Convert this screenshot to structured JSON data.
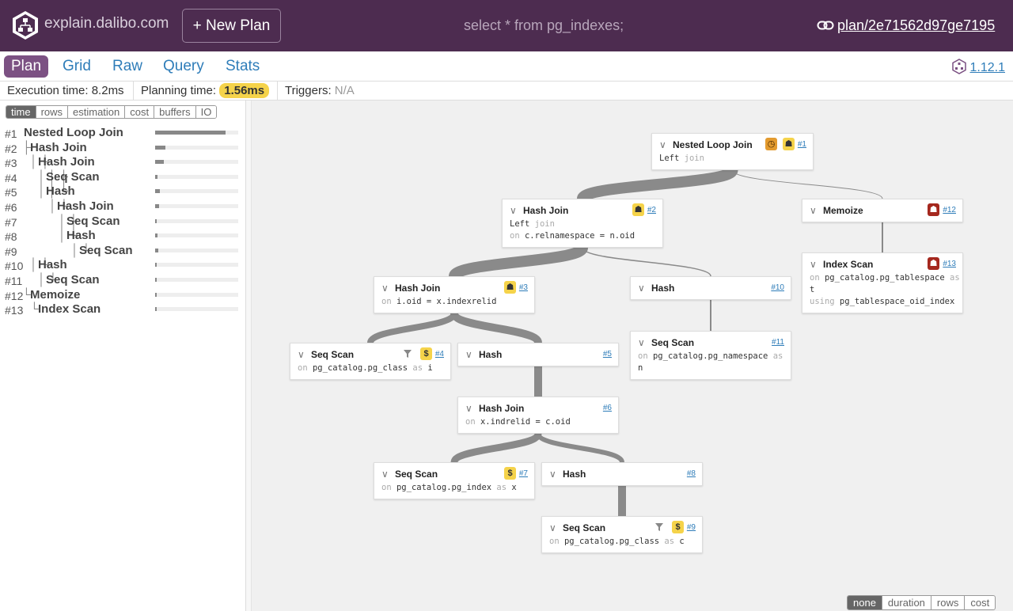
{
  "header": {
    "brand": "explain.dalibo.com",
    "new_plan_label": "+ New Plan",
    "query_title": "select * from pg_indexes;",
    "plan_link": "plan/2e71562d97ge7195"
  },
  "tabs": [
    {
      "label": "Plan",
      "active": true
    },
    {
      "label": "Grid",
      "active": false
    },
    {
      "label": "Raw",
      "active": false
    },
    {
      "label": "Query",
      "active": false
    },
    {
      "label": "Stats",
      "active": false
    }
  ],
  "version": "1.12.1",
  "info": {
    "execution_time": "Execution time: 8.2ms",
    "planning_label": "Planning time:",
    "planning_value": "1.56ms",
    "triggers_label": "Triggers:",
    "triggers_value": "N/A"
  },
  "metric_tabs": [
    {
      "label": "time",
      "active": true
    },
    {
      "label": "rows",
      "active": false
    },
    {
      "label": "estimation",
      "active": false
    },
    {
      "label": "cost",
      "active": false
    },
    {
      "label": "buffers",
      "active": false
    },
    {
      "label": "IO",
      "active": false
    }
  ],
  "tree": [
    {
      "num": "#1",
      "guide": "",
      "label": "Nested Loop Join",
      "fraction": 0.85
    },
    {
      "num": "#2",
      "guide": "├",
      "label": "Hash Join",
      "fraction": 0.12
    },
    {
      "num": "#3",
      "guide": "│ ├",
      "label": "Hash Join",
      "fraction": 0.1
    },
    {
      "num": "#4",
      "guide": "│ │ ├",
      "label": "Seq Scan",
      "fraction": 0.03
    },
    {
      "num": "#5",
      "guide": "│ │ └",
      "label": "Hash",
      "fraction": 0.06
    },
    {
      "num": "#6",
      "guide": "│     └",
      "label": "Hash Join",
      "fraction": 0.05
    },
    {
      "num": "#7",
      "guide": "│       ├",
      "label": "Seq Scan",
      "fraction": 0.02
    },
    {
      "num": "#8",
      "guide": "│       └",
      "label": "Hash",
      "fraction": 0.03
    },
    {
      "num": "#9",
      "guide": "│           └",
      "label": "Seq Scan",
      "fraction": 0.04
    },
    {
      "num": "#10",
      "guide": "│ └",
      "label": "Hash",
      "fraction": 0.02
    },
    {
      "num": "#11",
      "guide": "│   └",
      "label": "Seq Scan",
      "fraction": 0.02
    },
    {
      "num": "#12",
      "guide": "└",
      "label": "Memoize",
      "fraction": 0.02
    },
    {
      "num": "#13",
      "guide": "  └",
      "label": "Index Scan",
      "fraction": 0.01
    }
  ],
  "nodes": [
    {
      "id": "#1",
      "title": "Nested Loop Join",
      "badges": [
        "clock-icon:o",
        "elephant-icon:y"
      ],
      "filter": false,
      "lines": [
        [
          "Left",
          " join"
        ]
      ]
    },
    {
      "id": "#2",
      "title": "Hash Join",
      "badges": [
        "elephant-icon:y"
      ],
      "filter": false,
      "lines": [
        [
          "Left",
          " join"
        ],
        [
          "on",
          " c.relnamespace = n.oid"
        ]
      ]
    },
    {
      "id": "#3",
      "title": "Hash Join",
      "badges": [
        "elephant-icon:y"
      ],
      "filter": false,
      "lines": [
        [
          "on",
          " i.oid = x.indexrelid"
        ]
      ]
    },
    {
      "id": "#4",
      "title": "Seq Scan",
      "badges": [
        "dollar-icon:y"
      ],
      "filter": true,
      "lines": [
        [
          "on",
          " pg_catalog.pg_class",
          " as",
          " i"
        ]
      ]
    },
    {
      "id": "#5",
      "title": "Hash",
      "badges": [],
      "filter": false,
      "lines": []
    },
    {
      "id": "#6",
      "title": "Hash Join",
      "badges": [],
      "filter": false,
      "lines": [
        [
          "on",
          " x.indrelid = c.oid"
        ]
      ]
    },
    {
      "id": "#7",
      "title": "Seq Scan",
      "badges": [
        "dollar-icon:y"
      ],
      "filter": false,
      "lines": [
        [
          "on",
          " pg_catalog.pg_index",
          " as",
          " x"
        ]
      ]
    },
    {
      "id": "#8",
      "title": "Hash",
      "badges": [],
      "filter": false,
      "lines": []
    },
    {
      "id": "#9",
      "title": "Seq Scan",
      "badges": [
        "dollar-icon:y"
      ],
      "filter": true,
      "lines": [
        [
          "on",
          " pg_catalog.pg_class",
          " as",
          " c"
        ]
      ]
    },
    {
      "id": "#10",
      "title": "Hash",
      "badges": [],
      "filter": false,
      "lines": []
    },
    {
      "id": "#11",
      "title": "Seq Scan",
      "badges": [],
      "filter": false,
      "lines": [
        [
          "on",
          " pg_catalog.pg_namespace",
          " as",
          ""
        ],
        [
          "",
          "n"
        ]
      ]
    },
    {
      "id": "#12",
      "title": "Memoize",
      "badges": [
        "elephant-icon:r"
      ],
      "filter": false,
      "lines": []
    },
    {
      "id": "#13",
      "title": "Index Scan",
      "badges": [
        "elephant-icon:r"
      ],
      "filter": false,
      "lines": [
        [
          "on",
          " pg_catalog.pg_tablespace",
          " as",
          ""
        ],
        [
          "",
          "t"
        ],
        [
          "using",
          " pg_tablespace_oid_index"
        ]
      ]
    }
  ],
  "highlight_tabs": [
    {
      "label": "none",
      "active": true
    },
    {
      "label": "duration",
      "active": false
    },
    {
      "label": "rows",
      "active": false
    },
    {
      "label": "cost",
      "active": false
    }
  ],
  "colors": {
    "header_bg": "#4d2c50",
    "tab_active": "#7c5183",
    "link": "#2f7db9",
    "badge_yellow": "#f5d34a",
    "badge_orange": "#e39b2f",
    "badge_red": "#a5281e",
    "edge": "#8a8a8a"
  }
}
